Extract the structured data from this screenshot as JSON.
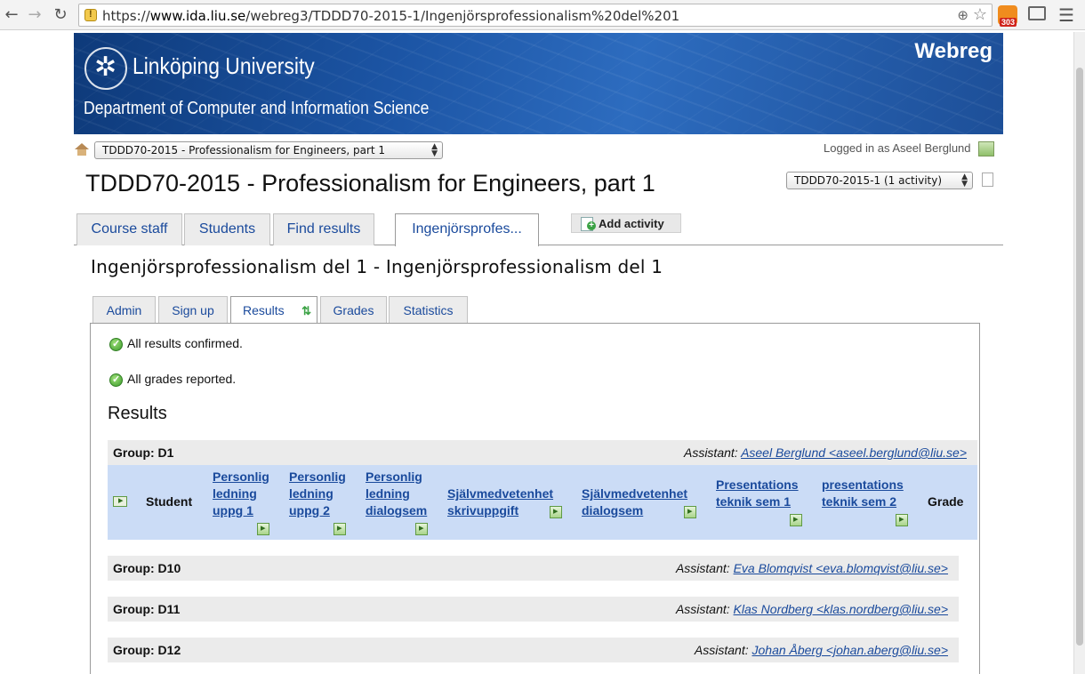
{
  "browser": {
    "url_prefix": "https://",
    "url_host": "www.ida.liu.se",
    "url_path": "/webreg3/TDDD70-2015-1/Ingenjörsprofessionalism%20del%201",
    "rss_badge": "303"
  },
  "banner": {
    "university": "Linköping University",
    "department": "Department of Computer and Information Science",
    "app_name": "Webreg"
  },
  "topbar": {
    "course_select_value": "TDDD70-2015 - Professionalism for Engineers, part 1",
    "logged_in_text": "Logged in as Aseel Berglund"
  },
  "page": {
    "title": "TDDD70-2015 - Professionalism for Engineers, part 1",
    "activity_select_value": "TDDD70-2015-1 (1 activity)"
  },
  "main_tabs": [
    {
      "label": "Course staff"
    },
    {
      "label": "Students"
    },
    {
      "label": "Find results"
    },
    {
      "label": "Ingenjörsprofes..."
    }
  ],
  "add_activity_label": "Add activity",
  "activity_title": "Ingenjörsprofessionalism del 1 - Ingenjörsprofessionalism del 1",
  "sub_tabs": [
    {
      "label": "Admin"
    },
    {
      "label": "Sign up"
    },
    {
      "label": "Results"
    },
    {
      "label": "Grades"
    },
    {
      "label": "Statistics"
    }
  ],
  "messages": {
    "results_confirmed": "All results confirmed.",
    "grades_reported": "All grades reported."
  },
  "results_heading": "Results",
  "assistant_label": "Assistant:",
  "columns": {
    "student": "Student",
    "c1": [
      "Personlig",
      "ledning",
      "uppg 1"
    ],
    "c2": [
      "Personlig",
      "ledning",
      "uppg 2"
    ],
    "c3": [
      "Personlig",
      "ledning",
      "dialogsem"
    ],
    "c4": [
      "Självmedvetenhet",
      "skrivuppgift"
    ],
    "c5": [
      "Självmedvetenhet",
      "dialogsem"
    ],
    "c6": [
      "Presentations",
      "teknik sem 1"
    ],
    "c7": [
      "presentations",
      "teknik sem 2"
    ],
    "grade": "Grade"
  },
  "groups": [
    {
      "label": "Group: D1",
      "assistant": "Aseel Berglund <aseel.berglund@liu.se>"
    },
    {
      "label": "Group: D10",
      "assistant": "Eva Blomqvist <eva.blomqvist@liu.se>"
    },
    {
      "label": "Group: D11",
      "assistant": "Klas Nordberg <klas.nordberg@liu.se>"
    },
    {
      "label": "Group: D12",
      "assistant": "Johan Åberg <johan.aberg@liu.se>"
    }
  ]
}
